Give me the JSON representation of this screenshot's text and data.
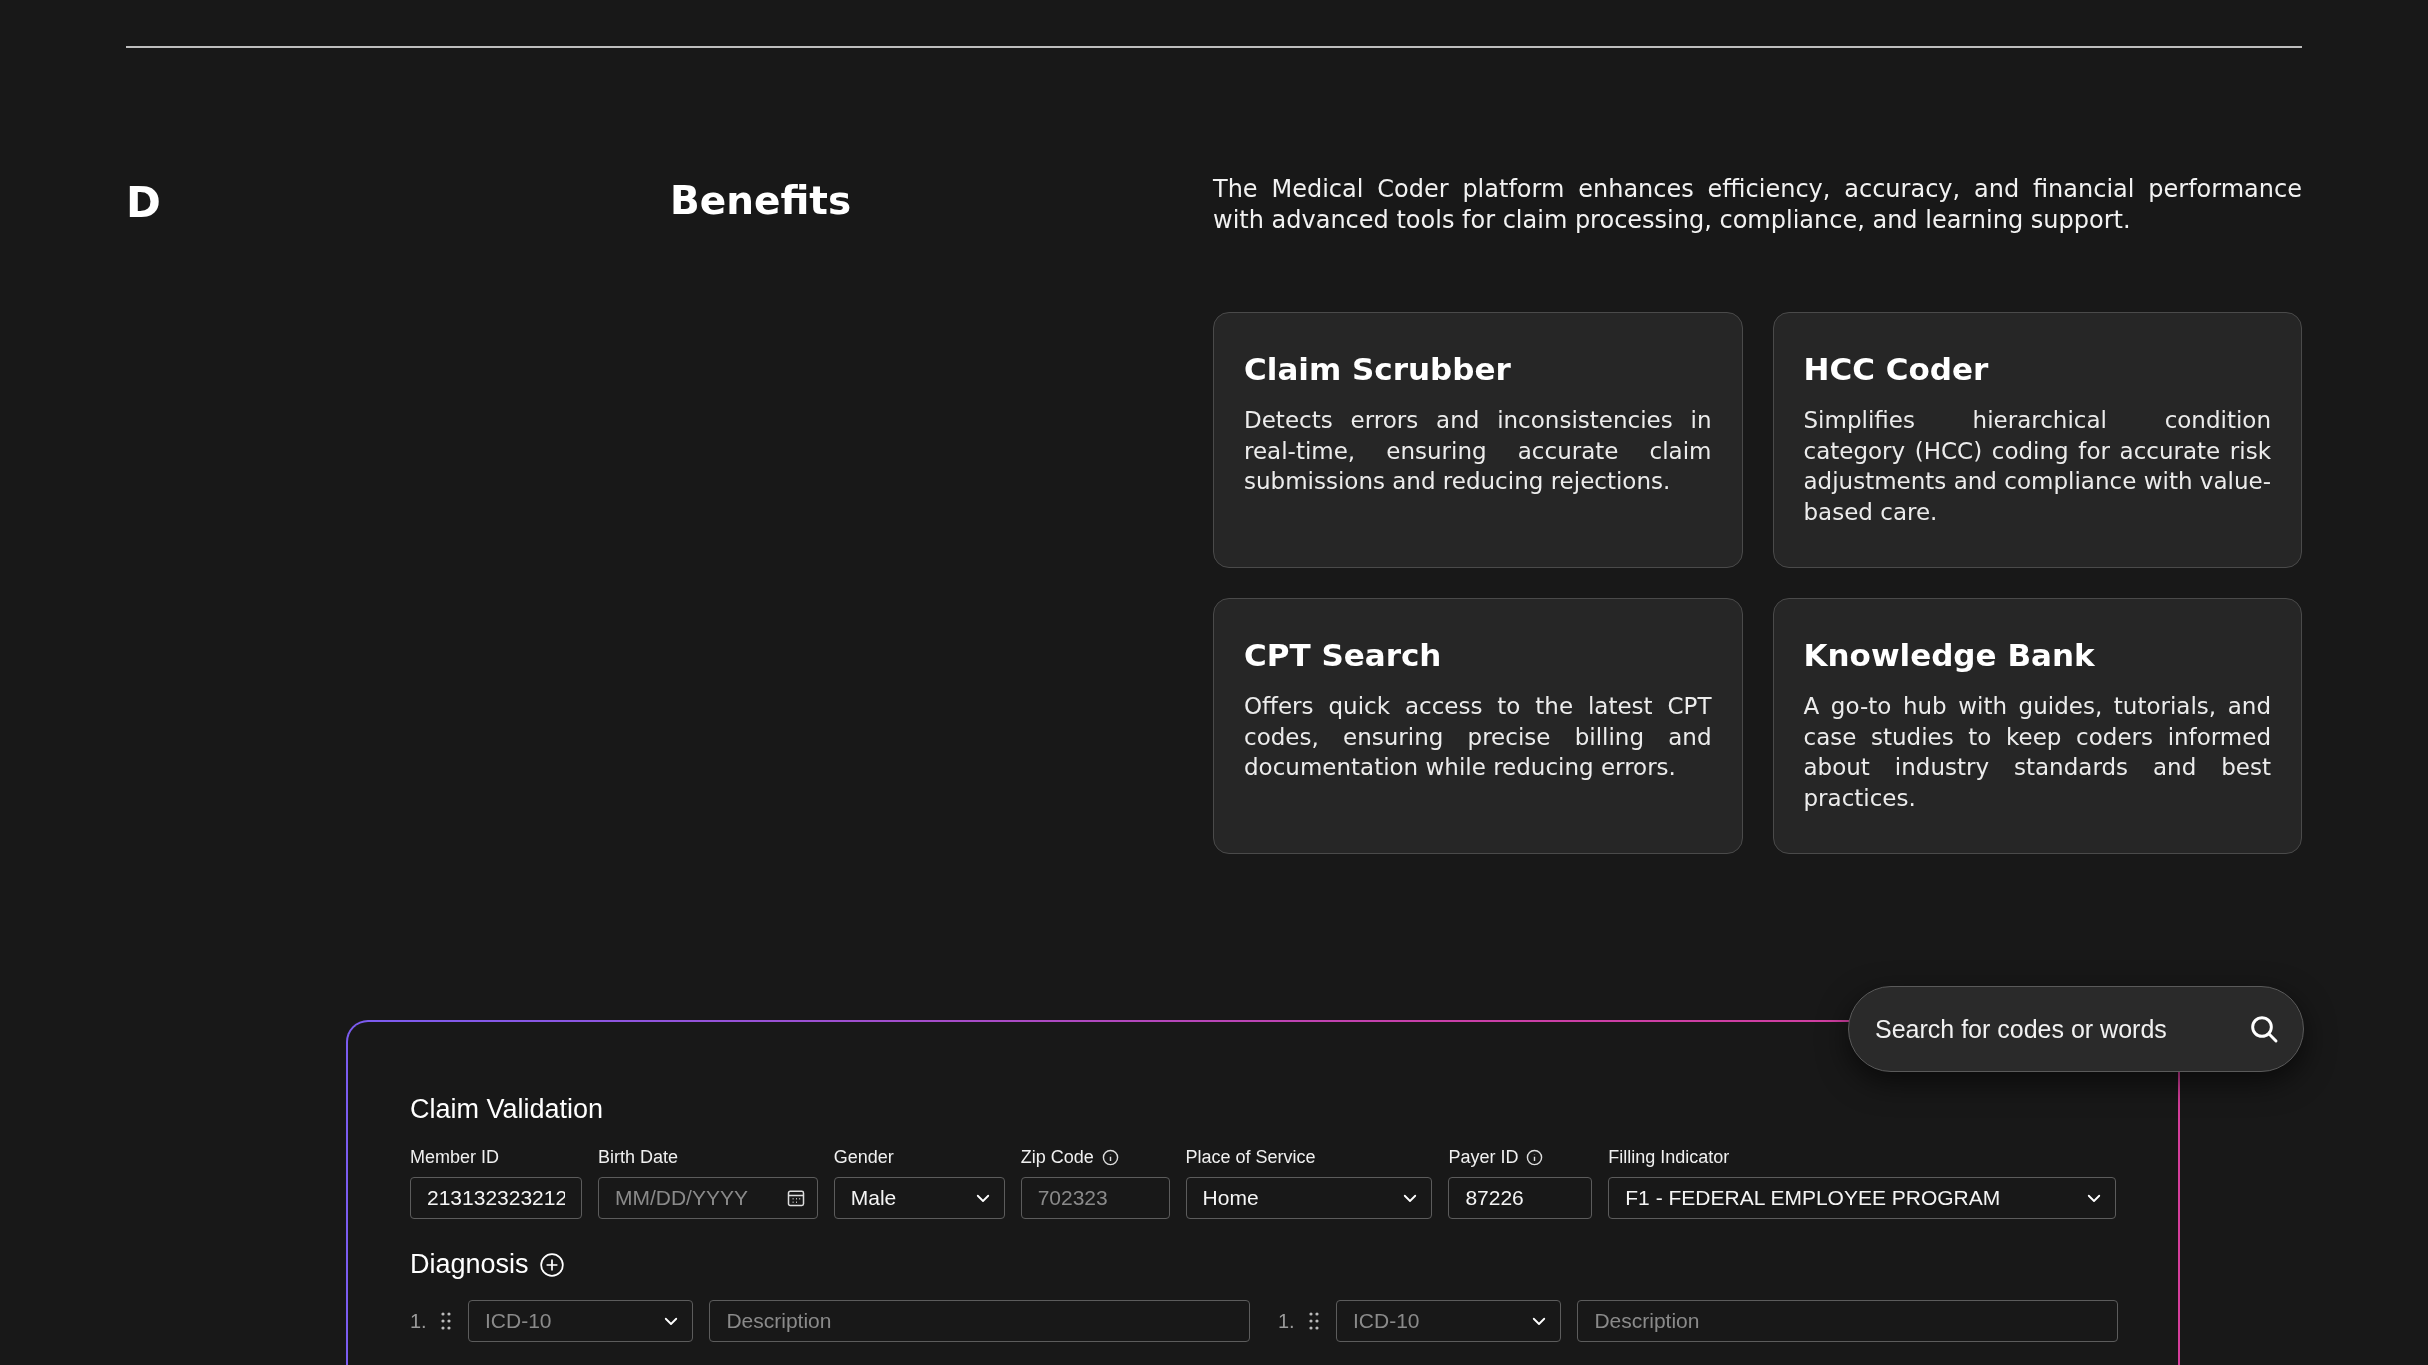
{
  "header": {
    "letter": "D",
    "title": "Benefits",
    "intro": "The Medical Coder platform enhances efficiency, accuracy, and financial performance with advanced tools for claim processing, compliance, and learning support."
  },
  "benefits": [
    {
      "title": "Claim Scrubber",
      "description": "Detects errors and inconsistencies in real-time, ensuring accurate claim submissions and reducing rejections."
    },
    {
      "title": "HCC Coder",
      "description": "Simplifies hierarchical condition category (HCC) coding for accurate risk adjustments and compliance with value-based care."
    },
    {
      "title": "CPT Search",
      "description": "Offers quick access to the latest CPT codes, ensuring precise billing and documentation while reducing errors."
    },
    {
      "title": "Knowledge Bank",
      "description": "A go-to hub with guides, tutorials, and case studies to keep coders informed about industry standards and best practices."
    }
  ],
  "search": {
    "placeholder": "Search for codes or words"
  },
  "claim_form": {
    "title": "Claim Validation",
    "fields": [
      {
        "label": "Member ID",
        "kind": "text",
        "value": "213132323212",
        "info": false
      },
      {
        "label": "Birth Date",
        "kind": "date",
        "placeholder": "MM/DD/YYYY",
        "info": false
      },
      {
        "label": "Gender",
        "kind": "select",
        "value": "Male",
        "info": false
      },
      {
        "label": "Zip Code",
        "kind": "text",
        "placeholder": "702323",
        "info": true
      },
      {
        "label": "Place of Service",
        "kind": "select",
        "value": "Home",
        "info": false
      },
      {
        "label": "Payer ID",
        "kind": "text",
        "value": "87226",
        "info": true
      },
      {
        "label": "Filling Indicator",
        "kind": "select",
        "value": "F1 - FEDERAL EMPLOYEE PROGRAM",
        "info": false
      }
    ],
    "diagnosis": {
      "title": "Diagnosis",
      "rows": [
        {
          "number": "1.",
          "code_placeholder": "ICD-10",
          "description_placeholder": "Description"
        },
        {
          "number": "1.",
          "code_placeholder": "ICD-10",
          "description_placeholder": "Description"
        }
      ]
    }
  }
}
